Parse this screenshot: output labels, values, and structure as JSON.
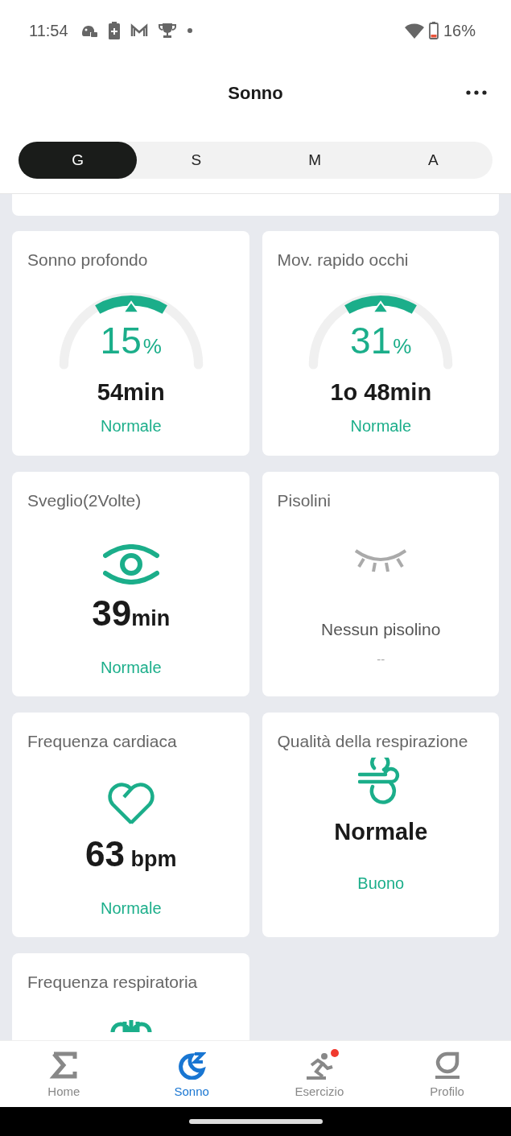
{
  "status_bar": {
    "time": "11:54",
    "battery": "16%"
  },
  "header": {
    "title": "Sonno"
  },
  "period_tabs": [
    {
      "label": "G",
      "selected": true
    },
    {
      "label": "S",
      "selected": false
    },
    {
      "label": "M",
      "selected": false
    },
    {
      "label": "A",
      "selected": false
    }
  ],
  "cards": [
    {
      "kind": "gauge",
      "title": "Sonno profondo",
      "value": "15",
      "unit": "%",
      "duration": "54min",
      "status": "Normale"
    },
    {
      "kind": "gauge",
      "title": "Mov. rapido occhi",
      "value": "31",
      "unit": "%",
      "duration": "1o 48min",
      "status": "Normale"
    },
    {
      "kind": "awake",
      "title": "Sveglio(2Volte)",
      "value": "39",
      "unit": "min",
      "status": "Normale"
    },
    {
      "kind": "naps",
      "title": "Pisolini",
      "message": "Nessun pisolino",
      "status": "--"
    },
    {
      "kind": "heart",
      "title": "Frequenza cardiaca",
      "value": "63",
      "unit": " bpm",
      "status": "Normale"
    },
    {
      "kind": "breath",
      "title": "Qualità della respirazione",
      "value": "Normale",
      "status": "Buono"
    },
    {
      "kind": "resp_rate",
      "title": "Frequenza respiratoria"
    }
  ],
  "bottom_nav": [
    {
      "label": "Home",
      "selected": false,
      "badge": false
    },
    {
      "label": "Sonno",
      "selected": true,
      "badge": false
    },
    {
      "label": "Esercizio",
      "selected": false,
      "badge": true
    },
    {
      "label": "Profilo",
      "selected": false,
      "badge": false
    }
  ]
}
